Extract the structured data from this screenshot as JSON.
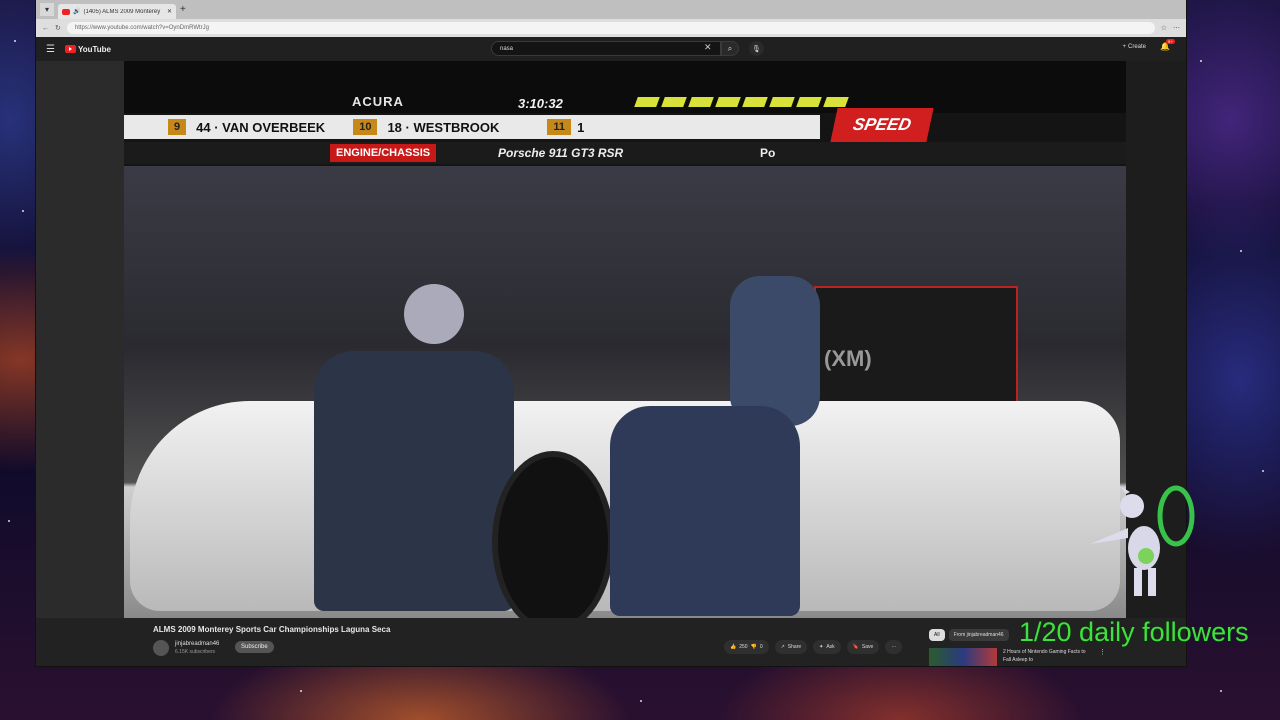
{
  "browser": {
    "tab_title": "(1405) ALMS 2009 Monterey",
    "url": "https://www.youtube.com/watch?v=OynDmRWtrJg"
  },
  "youtube": {
    "logo_text": "YouTube",
    "search_value": "nasa",
    "create_label": "Create",
    "notification_badge": "9+"
  },
  "overlay": {
    "acura": "ACURA",
    "clock": "3:10:32",
    "speed": "SPEED",
    "ticker": [
      {
        "pos": "9",
        "driver": "44 · VAN OVERBEEK"
      },
      {
        "pos": "10",
        "driver": "18 · WESTBROOK"
      },
      {
        "pos": "11",
        "driver": "1"
      }
    ],
    "engine_chassis": "ENGINE/CHASSIS",
    "car_model": "Porsche 911 GT3 RSR",
    "car_model_cut": "Po",
    "xm": "(XM)"
  },
  "video": {
    "title": "ALMS 2009 Monterey Sports Car Championships Laguna Seca",
    "channel": "jinjabreadman46",
    "subscribers": "6.15K subscribers",
    "subscribe_label": "Subscribe",
    "likes": "250",
    "dislikes": "0",
    "share_label": "Share",
    "ask_label": "Ask",
    "save_label": "Save",
    "more_label": "···"
  },
  "sidebar": {
    "chips": [
      "All",
      "From jinjabreadman46"
    ],
    "recommendation_title": "2 Hours of Nintendo Gaming Facts to Fall Asleep to"
  },
  "stream_overlay": {
    "followers_text": "1/20 daily followers"
  }
}
